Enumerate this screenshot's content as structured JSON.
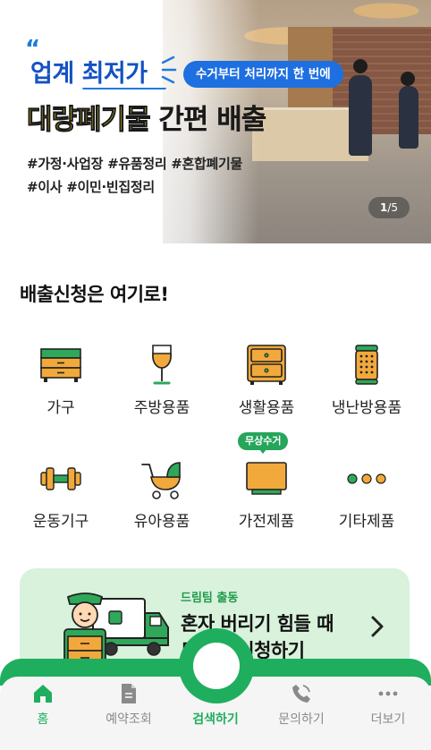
{
  "banner": {
    "quote": "“",
    "headline_line1": "업계 최저가",
    "pill": "수거부터 처리까지 한 번에",
    "headline_line2_highlight": "대량폐기물",
    "headline_line2_rest": " 간편 배출",
    "hashtags_line1": "#가정·사업장 #유품정리 #혼합폐기물",
    "hashtags_line2": "#이사 #이민·빈집정리",
    "page_current": "1",
    "page_total": "/5"
  },
  "section": {
    "title": "배출신청은 여기로!"
  },
  "categories": [
    {
      "label": "가구",
      "icon": "furniture-icon"
    },
    {
      "label": "주방용품",
      "icon": "wine-glass-icon"
    },
    {
      "label": "생활용품",
      "icon": "drawer-cabinet-icon"
    },
    {
      "label": "냉난방용품",
      "icon": "heater-icon"
    },
    {
      "label": "운동기구",
      "icon": "dumbbell-icon"
    },
    {
      "label": "유아용품",
      "icon": "stroller-icon"
    },
    {
      "label": "가전제품",
      "icon": "tv-icon",
      "badge": "무상수거"
    },
    {
      "label": "기타제품",
      "icon": "more-dots-icon"
    }
  ],
  "promo": {
    "subtitle": "드림팀 출동",
    "title_line1": "혼자 버리기 힘들 때",
    "title_line2": "드림팀 신청하기",
    "icon": "delivery-truck-person-icon"
  },
  "nav": {
    "items": [
      {
        "label": "홈",
        "icon": "home-icon",
        "active": true
      },
      {
        "label": "예약조회",
        "icon": "document-icon",
        "active": false
      },
      {
        "label": "검색하기",
        "icon": "search-icon",
        "active": false
      },
      {
        "label": "문의하기",
        "icon": "phone-icon",
        "active": false
      },
      {
        "label": "더보기",
        "icon": "more-horizontal-icon",
        "active": false
      }
    ]
  },
  "colors": {
    "brand_green": "#1fae5e",
    "promo_bg": "#d8f2dc",
    "banner_blue": "#1352c4",
    "pill_blue": "#1e6fe0",
    "highlight_yellow": "#ffe01b",
    "icon_orange": "#f2a93b"
  }
}
